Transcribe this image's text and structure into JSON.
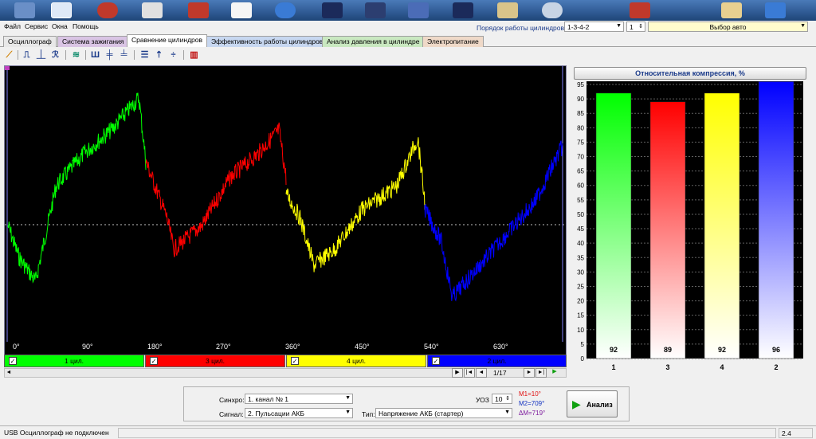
{
  "menu": {
    "items": [
      "Файл",
      "Сервис",
      "Окна",
      "Помощь"
    ]
  },
  "header": {
    "order_label": "Порядок работы цилиндров",
    "order_value": "1-3-4-2",
    "cyl_select": "1",
    "auto_select": "Выбор авто"
  },
  "tabs": [
    {
      "label": "Осциллограф",
      "color": "#e8e8e8"
    },
    {
      "label": "Система зажигания",
      "color": "#d9c4e4"
    },
    {
      "label": "Сравнение цилиндров",
      "color": "#ffffff"
    },
    {
      "label": "Эффективность работы цилиндров",
      "color": "#c7d7f0"
    },
    {
      "label": "Анализ давления в цилиндре",
      "color": "#c9e8c0"
    },
    {
      "label": "Электропитание",
      "color": "#efd9c8"
    }
  ],
  "scope": {
    "angles": [
      "0°",
      "90°",
      "180°",
      "270°",
      "360°",
      "450°",
      "540°",
      "630°"
    ],
    "cylinders": [
      {
        "label": "1 цил.",
        "color": "#00ff00"
      },
      {
        "label": "3 цил.",
        "color": "#ff0000"
      },
      {
        "label": "4 цил.",
        "color": "#ffff00"
      },
      {
        "label": "2 цил.",
        "color": "#0000ff"
      }
    ],
    "page": "1/17"
  },
  "chart_data": {
    "type": "bar",
    "title": "Относительная компрессия, %",
    "categories": [
      "1",
      "3",
      "4",
      "2"
    ],
    "values": [
      92,
      89,
      92,
      96
    ],
    "colors": [
      "#00ff00",
      "#ff0000",
      "#ffff00",
      "#0000ff"
    ],
    "ylim": [
      0,
      95
    ],
    "yticks": [
      0,
      5,
      10,
      15,
      20,
      25,
      30,
      35,
      40,
      45,
      50,
      55,
      60,
      65,
      70,
      75,
      80,
      85,
      90,
      95
    ],
    "grid": true
  },
  "controls": {
    "sync_label": "Синхро:",
    "sync_value": "1. канал № 1",
    "signal_label": "Сигнал:",
    "signal_value": "2. Пульсации АКБ",
    "type_label": "Тип:",
    "type_value": "Напряжение АКБ (стартер)",
    "uoz_label": "УОЗ",
    "uoz_value": "10",
    "m1": "M1=10°",
    "m2": "M2=709°",
    "dm": "ΔM=719°",
    "analyze_label": "Анализ"
  },
  "status": {
    "text": "USB Осциллограф не подключен",
    "version": "2.4"
  }
}
